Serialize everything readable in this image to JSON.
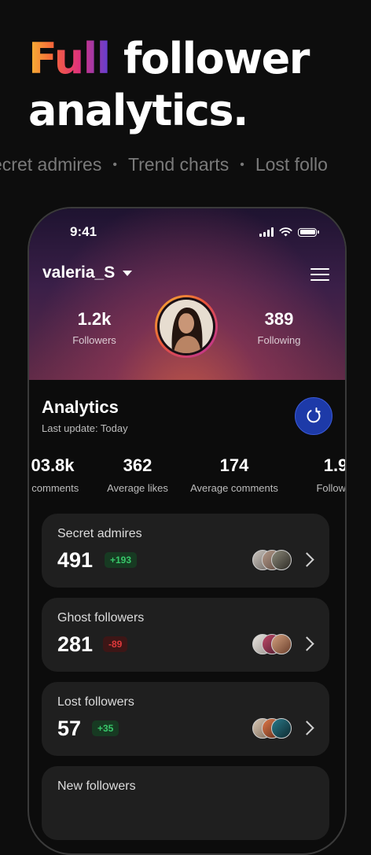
{
  "headline": {
    "word1": "Full",
    "word2": "follower",
    "line2": "analytics."
  },
  "ticker": [
    "ecret admires",
    "Trend charts",
    "Lost follo"
  ],
  "ticker_separator": "•",
  "status": {
    "time": "9:41"
  },
  "profile": {
    "username": "valeria_S",
    "followers": {
      "value": "1.2k",
      "label": "Followers"
    },
    "following": {
      "value": "389",
      "label": "Following"
    }
  },
  "analytics": {
    "title": "Analytics",
    "last_update": "Last update: Today",
    "stats": [
      {
        "value": "03.8k",
        "label": "l comments"
      },
      {
        "value": "362",
        "label": "Average likes"
      },
      {
        "value": "174",
        "label": "Average comments"
      },
      {
        "value": "1.9",
        "label": "Follower"
      }
    ]
  },
  "cards": [
    {
      "title": "Secret admires",
      "value": "491",
      "badge": "+193",
      "trend": "up"
    },
    {
      "title": "Ghost followers",
      "value": "281",
      "badge": "-89",
      "trend": "down"
    },
    {
      "title": "Lost followers",
      "value": "57",
      "badge": "+35",
      "trend": "up"
    },
    {
      "title": "New followers",
      "value": "",
      "badge": "",
      "trend": "up"
    }
  ],
  "colors": {
    "background": "#0d0d0d",
    "card": "#1f1f1f",
    "accent_blue": "#1d3aa8",
    "positive": "#38c76a",
    "negative": "#e0393b"
  }
}
